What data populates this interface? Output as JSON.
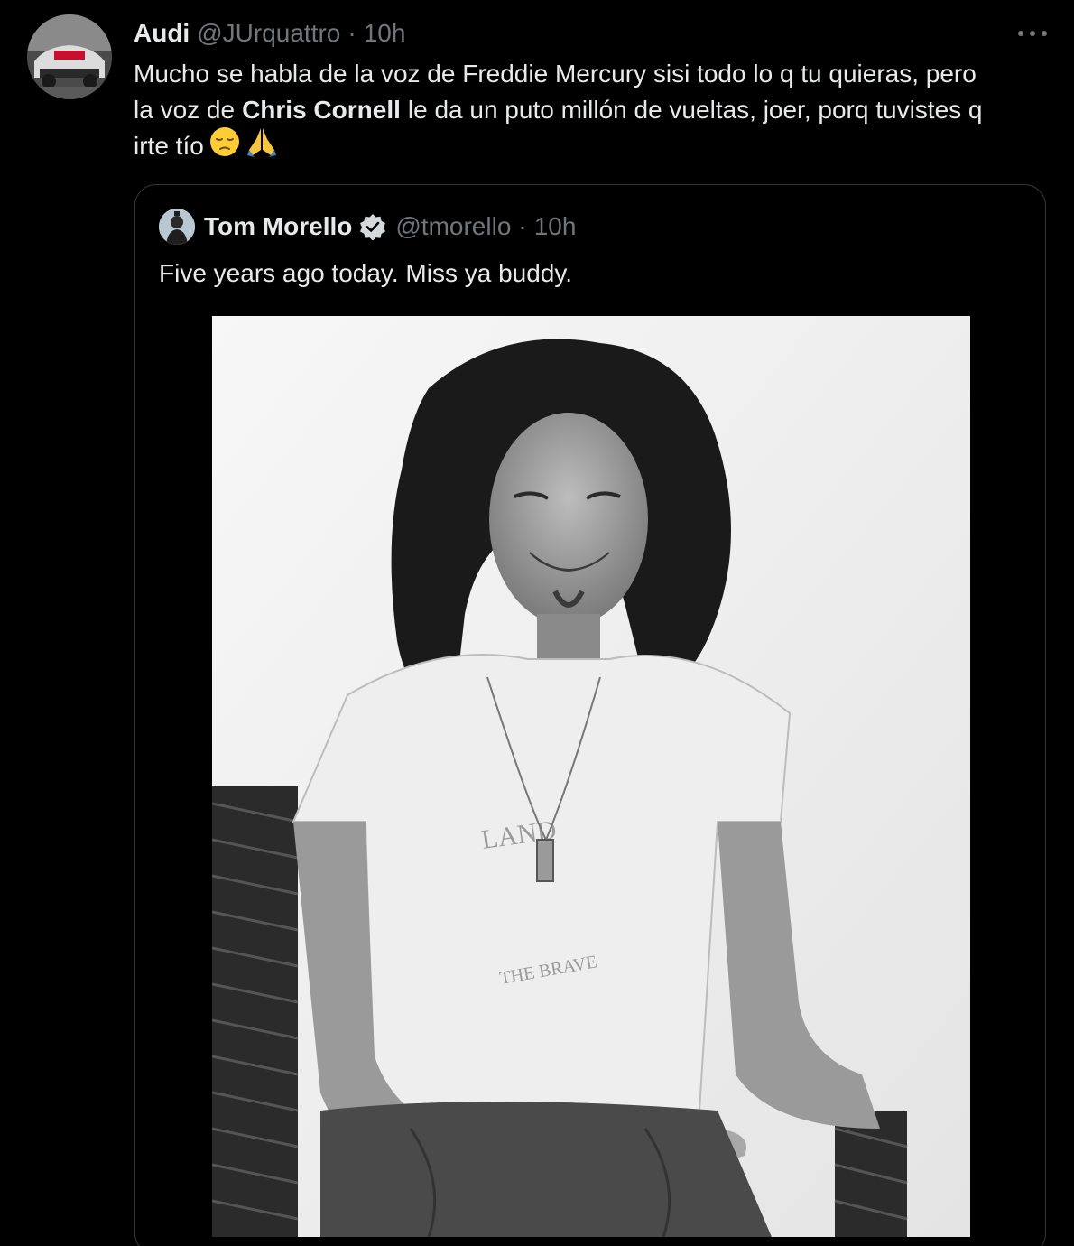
{
  "tweet": {
    "author_name": "Audi",
    "author_handle": "@JUrquattro",
    "separator": "·",
    "time": "10h",
    "text_line1": "Mucho se habla de la voz de Freddie Mercury sisi todo lo q tu quieras, pero",
    "text_line2_pre": "la voz de",
    "text_line2_bold": "Chris Cornell",
    "text_line2_post": "le da un puto millón de vueltas, joer, porq tuvistes q",
    "text_line3": "irte tío",
    "emojis": [
      "pensive-face",
      "folded-hands"
    ],
    "more_icon": "more-horizontal-icon"
  },
  "quote": {
    "author_name": "Tom Morello",
    "verified_icon": "verified-badge-icon",
    "author_handle": "@tmorello",
    "separator": "·",
    "time": "10h",
    "text": "Five years ago today. Miss ya buddy.",
    "photo": "black-and-white portrait photo"
  },
  "colors": {
    "background": "#000000",
    "text_primary": "#e7e9ea",
    "text_secondary": "#71767b",
    "border": "#333639"
  }
}
